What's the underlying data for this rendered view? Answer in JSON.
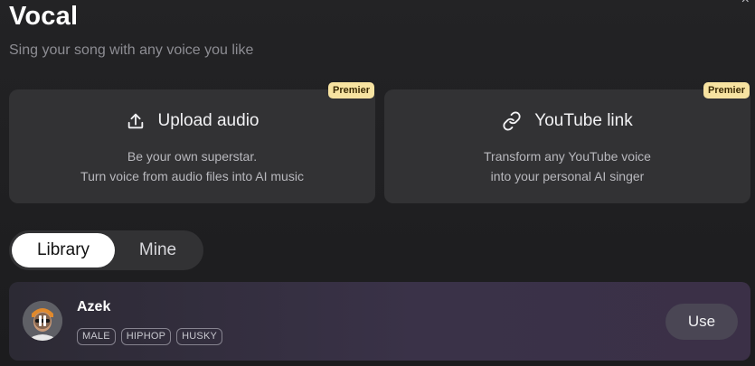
{
  "header": {
    "title": "Vocal",
    "subtitle": "Sing your song with any voice you like"
  },
  "cards": [
    {
      "title": "Upload audio",
      "badge": "Premier",
      "desc_line1": "Be your own superstar.",
      "desc_line2": "Turn voice from audio files into AI music",
      "icon": "upload-icon"
    },
    {
      "title": "YouTube link",
      "badge": "Premier",
      "desc_line1": "Transform any YouTube voice",
      "desc_line2": "into your personal AI singer",
      "icon": "link-icon"
    }
  ],
  "tabs": {
    "library": "Library",
    "mine": "Mine",
    "active": "library"
  },
  "voices": [
    {
      "name": "Azek",
      "tags": [
        "MALE",
        "HIPHOP",
        "HUSKY"
      ],
      "action": "Use",
      "state": "paused"
    }
  ],
  "colors": {
    "badge_bg": "#f7e3a1",
    "card_bg": "#323234",
    "row_gradient_end": "#3b3047"
  }
}
